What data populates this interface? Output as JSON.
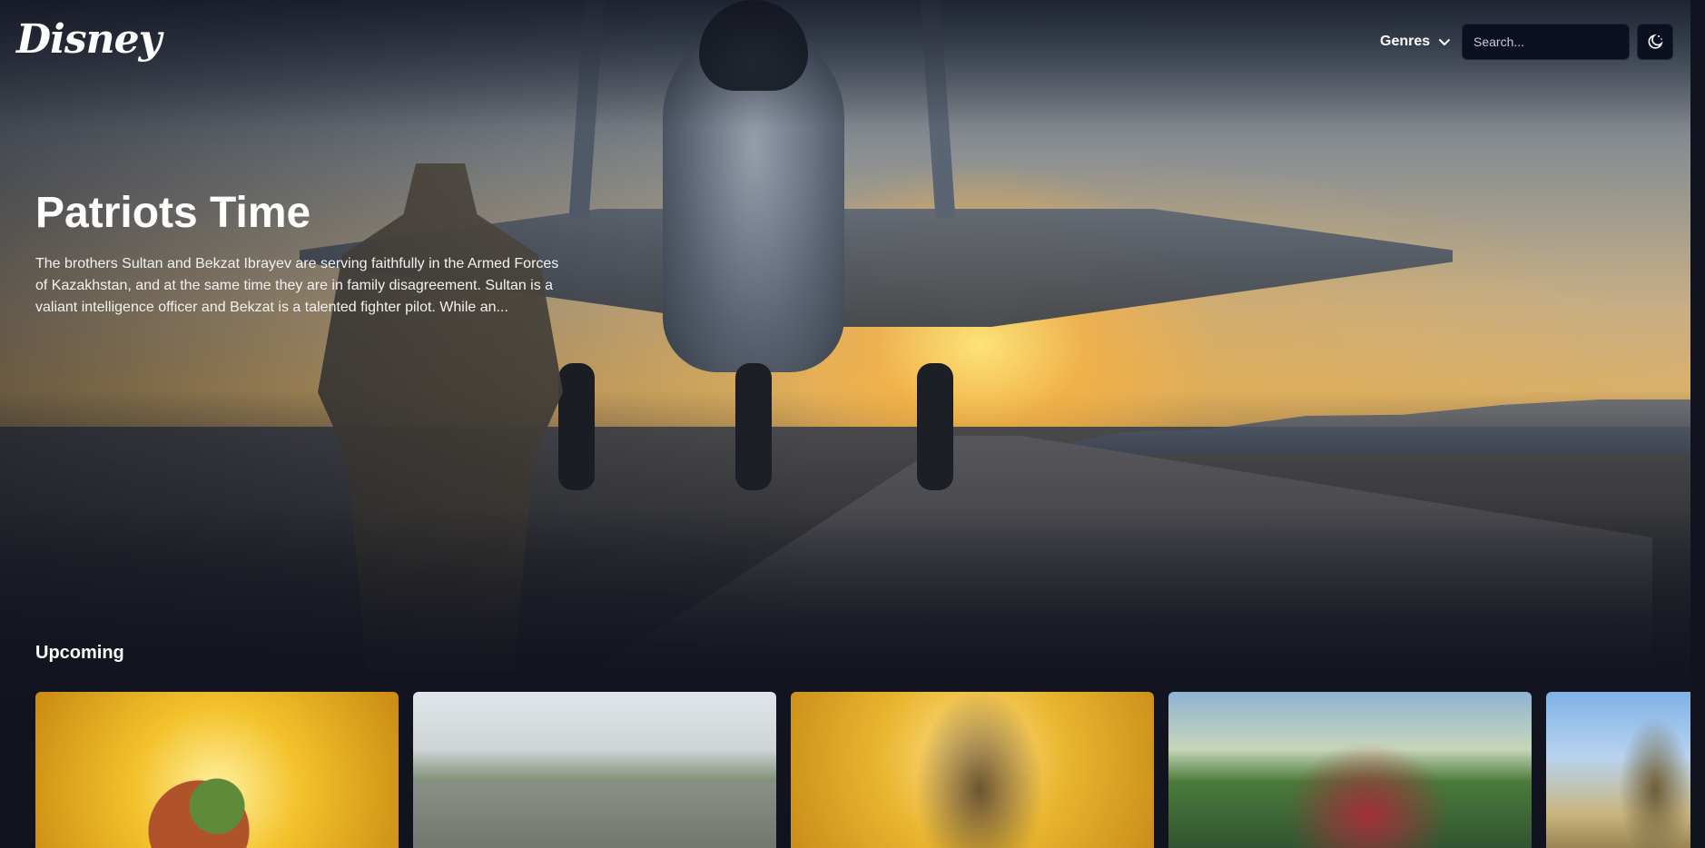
{
  "brand": {
    "logo_text": "Disney"
  },
  "nav": {
    "genres_label": "Genres",
    "search_placeholder": "Search...",
    "theme_toggle_icon": "moon-stars-icon"
  },
  "hero": {
    "title": "Patriots Time",
    "description": "The brothers Sultan and Bekzat Ibrayev are serving faithfully in the Armed Forces of Kazakhstan, and at the same time they are in family disagreement. Sultan is a valiant intelligence officer and Bekzat is a talented fighter pilot. While an..."
  },
  "sections": {
    "upcoming": {
      "title": "Upcoming",
      "cards": [
        {
          "image": "animated ducks poster"
        },
        {
          "image": "family playing outdoors"
        },
        {
          "image": "man surrounded by bees"
        },
        {
          "image": "anime boy carrying girl"
        },
        {
          "image": "city tower view"
        }
      ]
    }
  },
  "colors": {
    "background": "#11141f",
    "input_background": "#0b1020",
    "text": "#ffffff"
  }
}
